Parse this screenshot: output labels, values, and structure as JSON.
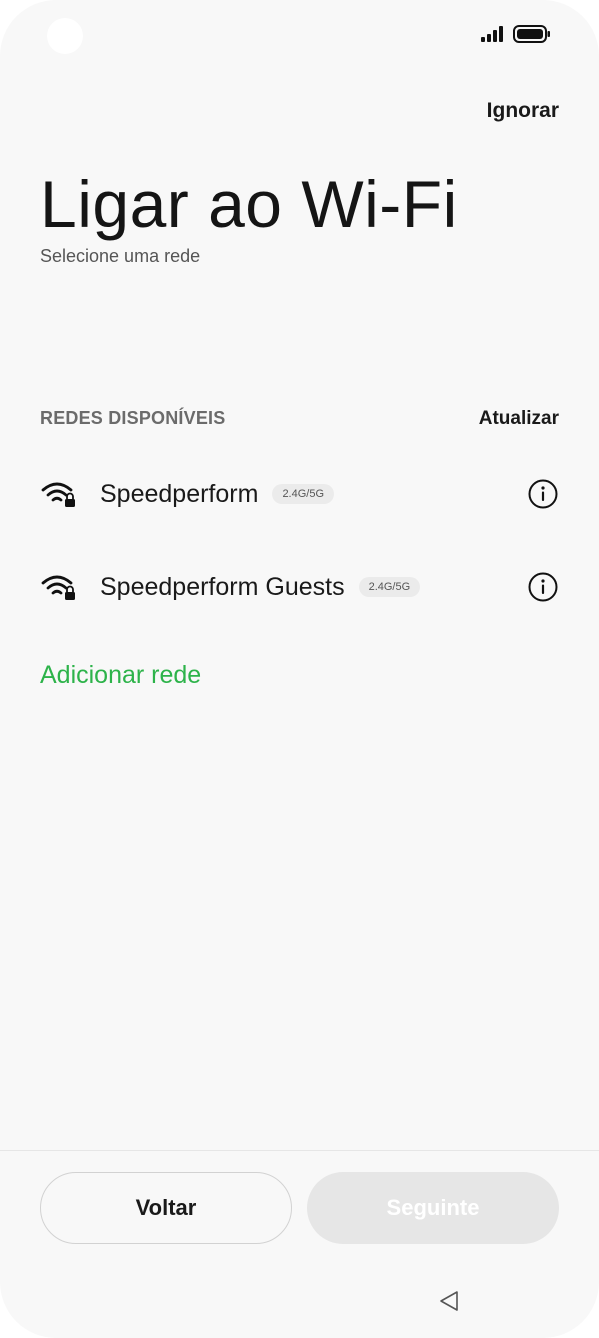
{
  "status_bar": {
    "signal_icon": "signal-bars-icon",
    "battery_icon": "battery-full-icon"
  },
  "header": {
    "skip_label": "Ignorar",
    "title": "Ligar ao Wi-Fi",
    "subtitle": "Selecione uma rede"
  },
  "networks": {
    "section_label": "REDES DISPONÍVEIS",
    "refresh_label": "Atualizar",
    "items": [
      {
        "name": "Speedperform",
        "band": "2.4G/5G",
        "icon": "wifi-locked-icon"
      },
      {
        "name": "Speedperform Guests",
        "band": "2.4G/5G",
        "icon": "wifi-locked-icon"
      }
    ],
    "add_label": "Adicionar rede"
  },
  "footer": {
    "back_label": "Voltar",
    "next_label": "Seguinte"
  },
  "colors": {
    "accent": "#2db34a",
    "background": "#f8f8f8",
    "disabled_button": "#e6e6e6"
  }
}
